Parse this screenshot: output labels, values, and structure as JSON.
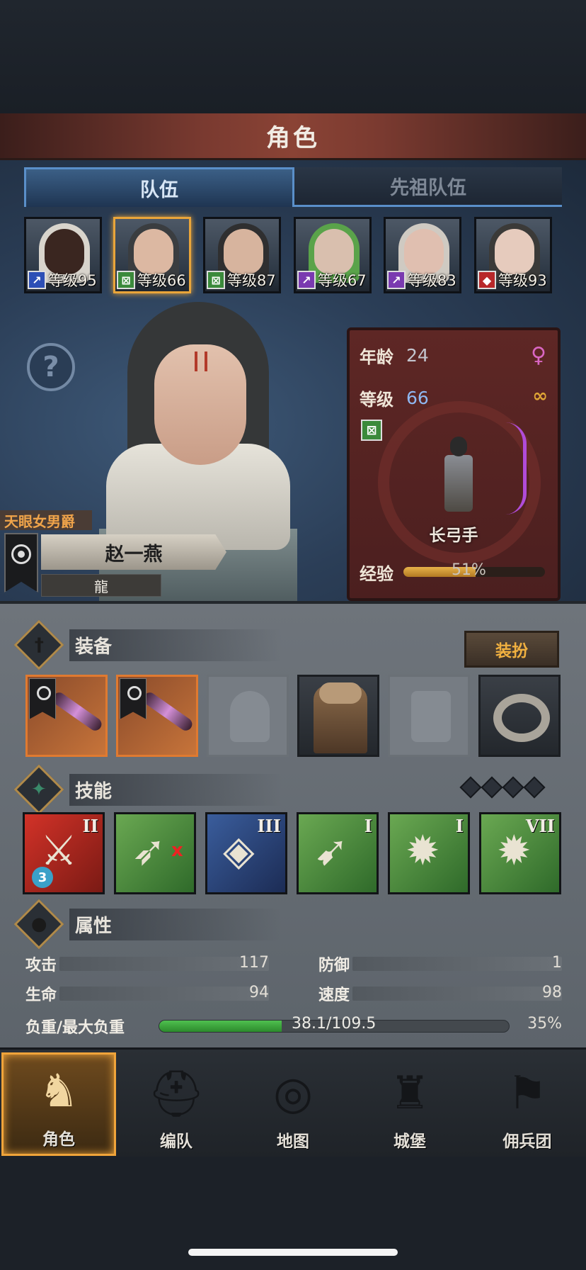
{
  "header": {
    "title": "角色"
  },
  "tabs": [
    {
      "label": "队伍",
      "active": true
    },
    {
      "label": "先祖队伍",
      "active": false
    }
  ],
  "roster": [
    {
      "level_text": "等级95",
      "class_icon": "sword-class-icon",
      "class_color": "#2d4fb6",
      "skin": "#3a2620",
      "hair": "#d8d4cc"
    },
    {
      "level_text": "等级66",
      "class_icon": "bow-class-icon",
      "class_color": "#3b8a3b",
      "skin": "#dcb8a2",
      "hair": "#3a3d40",
      "selected": true
    },
    {
      "level_text": "等级87",
      "class_icon": "bow-class-icon",
      "class_color": "#3b8a3b",
      "skin": "#d7b49e",
      "hair": "#2f2f30"
    },
    {
      "level_text": "等级67",
      "class_icon": "staff-class-icon",
      "class_color": "#7a3ab0",
      "skin": "#d9bfae",
      "hair": "#5aa34a"
    },
    {
      "level_text": "等级83",
      "class_icon": "staff-class-icon",
      "class_color": "#7a3ab0",
      "skin": "#e0bfb0",
      "hair": "#cfcac2"
    },
    {
      "level_text": "等级93",
      "class_icon": "beast-class-icon",
      "class_color": "#b8282a",
      "skin": "#e6cbbd",
      "hair": "#3b3a38"
    }
  ],
  "character": {
    "title": "天眼女男爵",
    "name": "赵一燕",
    "subname": "龍",
    "age_label": "年龄",
    "age": "24",
    "level_label": "等级",
    "level": "66",
    "class_name": "长弓手",
    "exp_label": "经验",
    "exp_text": "51%",
    "exp_fraction": 0.51,
    "gender_icon": "female-icon",
    "marriage_icon": "rings-icon"
  },
  "equipment": {
    "title": "装备",
    "dress_button": "装扮",
    "slots": [
      {
        "icon": "longbow-item-icon",
        "state": "equipped-rare"
      },
      {
        "icon": "longbow-item-icon",
        "state": "equipped-rare"
      },
      {
        "icon": "helmet-slot-icon",
        "state": "empty"
      },
      {
        "icon": "fur-coat-item-icon",
        "state": "equipped"
      },
      {
        "icon": "boots-slot-icon",
        "state": "empty"
      },
      {
        "icon": "ring-item-icon",
        "state": "equipped"
      }
    ]
  },
  "skills": {
    "title": "技能",
    "points": 4,
    "items": [
      {
        "tier": "II",
        "color": "red",
        "icon": "arrow-dash-skill-icon",
        "badge": "3"
      },
      {
        "tier": "",
        "color": "green",
        "icon": "arrow-cancel-skill-icon",
        "mark": "x"
      },
      {
        "tier": "III",
        "color": "blue",
        "icon": "crystal-arrow-skill-icon"
      },
      {
        "tier": "I",
        "color": "green",
        "icon": "dash-skill-icon"
      },
      {
        "tier": "I",
        "color": "green",
        "icon": "burst-skill-icon"
      },
      {
        "tier": "VII",
        "color": "green",
        "icon": "burst-skill-icon"
      }
    ]
  },
  "attributes": {
    "title": "属性",
    "attack_label": "攻击",
    "attack": "117",
    "defense_label": "防御",
    "defense": "1",
    "hp_label": "生命",
    "hp": "94",
    "speed_label": "速度",
    "speed": "98",
    "load_label": "负重/最大负重",
    "load_text": "38.1/109.5",
    "load_percent": "35%",
    "load_fraction": 0.35
  },
  "nav": [
    {
      "label": "角色",
      "icon": "knight-icon",
      "active": true
    },
    {
      "label": "编队",
      "icon": "helmet-icon"
    },
    {
      "label": "地图",
      "icon": "compass-icon"
    },
    {
      "label": "城堡",
      "icon": "castle-icon"
    },
    {
      "label": "佣兵团",
      "icon": "banner-icon"
    }
  ]
}
